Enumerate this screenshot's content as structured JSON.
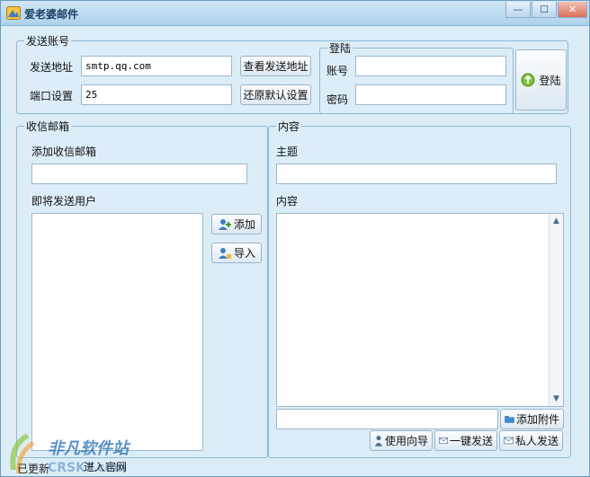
{
  "window": {
    "title": "爱老婆邮件",
    "minimize": "—",
    "maximize": "☐",
    "close": "✕"
  },
  "send_account": {
    "legend": "发送账号",
    "address_label": "发送地址",
    "address_value": "smtp.qq.com",
    "port_label": "端口设置",
    "port_value": "25",
    "view_button": "查看发送地址",
    "restore_button": "还原默认设置"
  },
  "login": {
    "legend": "登陆",
    "account_label": "账号",
    "account_value": "",
    "password_label": "密码",
    "password_value": "",
    "login_button": "登陆"
  },
  "inbox": {
    "legend": "收信邮箱",
    "add_label": "添加收信邮箱",
    "add_value": "",
    "pending_label": "即将发送用户",
    "add_button": "添加",
    "import_button": "导入"
  },
  "content": {
    "legend": "内容",
    "subject_label": "主题",
    "subject_value": "",
    "body_label": "内容",
    "attachment_value": "",
    "attach_button": "添加附件",
    "guide_button": "使用向导",
    "send_all_button": "一键发送",
    "private_send_button": "私人发送"
  },
  "status": {
    "left": "已更新",
    "right": "进入官网"
  },
  "watermark": {
    "text": "非凡软件站",
    "sub": "CRSKY.com"
  },
  "colors": {
    "window_bg": "#dcedf7",
    "border": "#8fb8d6",
    "accent": "#2a6fb3"
  }
}
